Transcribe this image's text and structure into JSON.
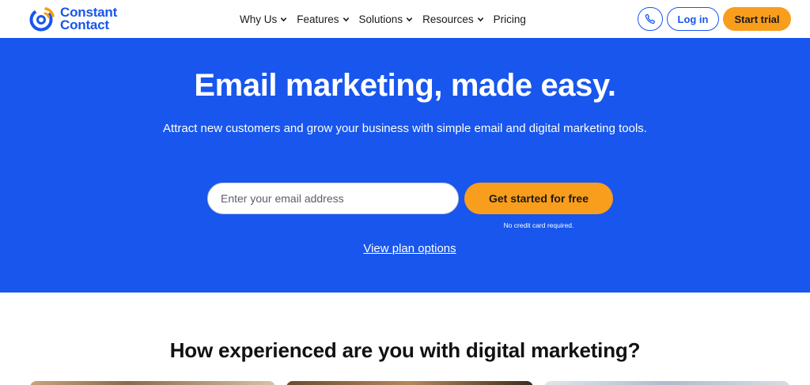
{
  "brand": {
    "name_line1": "Constant",
    "name_line2": "Contact",
    "color_primary": "#1856ed",
    "color_accent": "#f99d1c"
  },
  "nav": {
    "items": [
      {
        "label": "Why Us",
        "has_dropdown": true
      },
      {
        "label": "Features",
        "has_dropdown": true
      },
      {
        "label": "Solutions",
        "has_dropdown": true
      },
      {
        "label": "Resources",
        "has_dropdown": true
      },
      {
        "label": "Pricing",
        "has_dropdown": false
      }
    ]
  },
  "header_actions": {
    "phone_icon": "phone-icon",
    "login_label": "Log in",
    "trial_label": "Start trial"
  },
  "hero": {
    "title": "Email marketing, made easy.",
    "subtitle": "Attract new customers and grow your business with simple email and digital marketing tools.",
    "email_placeholder": "Enter your email address",
    "cta_label": "Get started for free",
    "note": "No credit card required.",
    "plans_link": "View plan options"
  },
  "section": {
    "title": "How experienced are you with digital marketing?"
  }
}
